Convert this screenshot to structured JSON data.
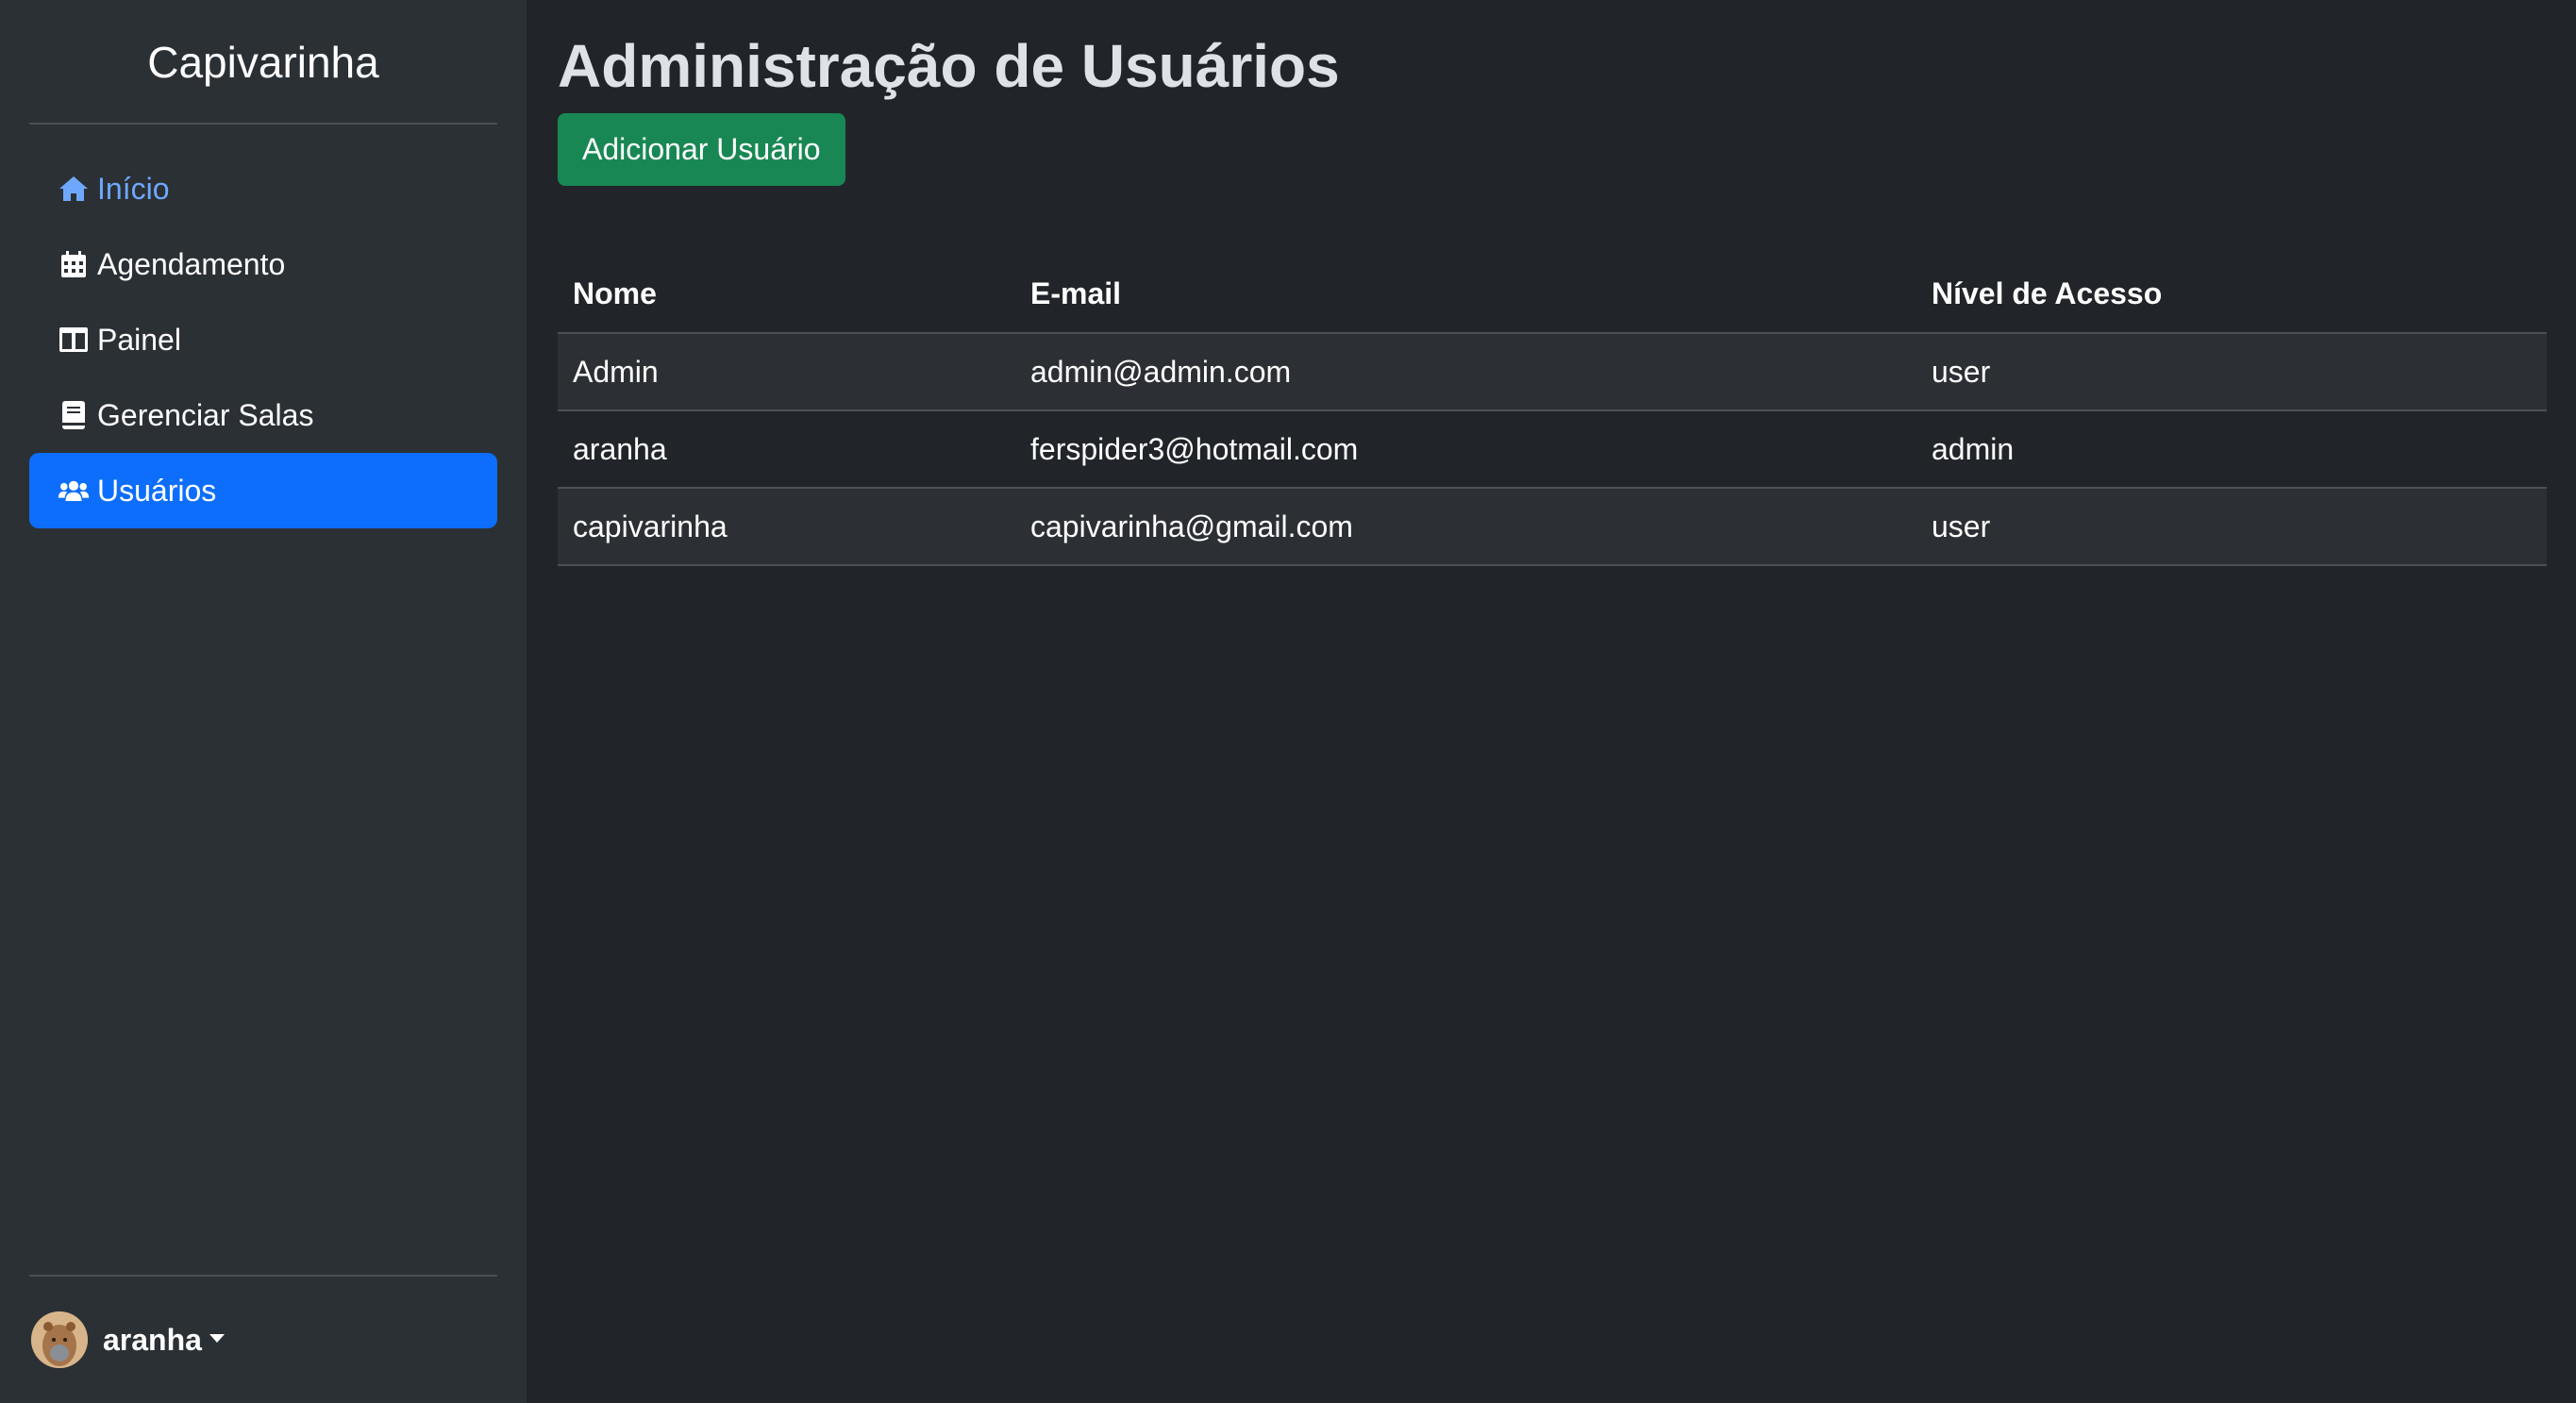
{
  "app": {
    "brand": "Capivarinha"
  },
  "sidebar": {
    "items": [
      {
        "label": "Início",
        "icon": "home-icon"
      },
      {
        "label": "Agendamento",
        "icon": "calendar-icon"
      },
      {
        "label": "Painel",
        "icon": "columns-icon"
      },
      {
        "label": "Gerenciar Salas",
        "icon": "book-icon"
      },
      {
        "label": "Usuários",
        "icon": "users-icon"
      }
    ],
    "active": "Usuários",
    "user": {
      "name": "aranha",
      "avatar": "capybara-avatar"
    }
  },
  "main": {
    "title": "Administração de Usuários",
    "add_button": "Adicionar Usuário",
    "table": {
      "headers": [
        "Nome",
        "E-mail",
        "Nível de Acesso"
      ],
      "rows": [
        [
          "Admin",
          "admin@admin.com",
          "user"
        ],
        [
          "aranha",
          "ferspider3@hotmail.com",
          "admin"
        ],
        [
          "capivarinha",
          "capivarinha@gmail.com",
          "user"
        ]
      ]
    }
  },
  "colors": {
    "background": "#212529",
    "sidebar": "#2b3035",
    "active": "#0d6efd",
    "link": "#6ea8fe",
    "success": "#198754"
  }
}
